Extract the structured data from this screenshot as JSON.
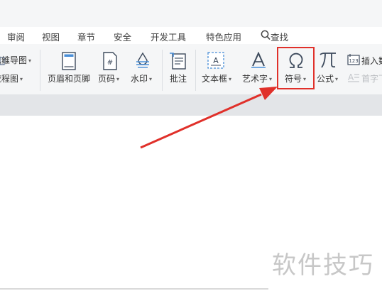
{
  "menu_tabs": [
    "审阅",
    "视图",
    "章节",
    "安全",
    "开发工具",
    "特色应用",
    "查找"
  ],
  "ribbon": {
    "mindmap_label": "思维导图",
    "flowchart_label": "流程图",
    "header_footer_label": "页眉和页脚",
    "page_number_label": "页码",
    "watermark_label": "水印",
    "comment_label": "批注",
    "textbox_label": "文本框",
    "wordart_label": "艺术字",
    "symbol_label": "符号",
    "formula_label": "公式",
    "insert_number_label": "插入数",
    "dropcap_label": "首字下"
  },
  "overlay": {
    "watermark_text": "软件技巧",
    "highlight_color": "#e0302a"
  }
}
